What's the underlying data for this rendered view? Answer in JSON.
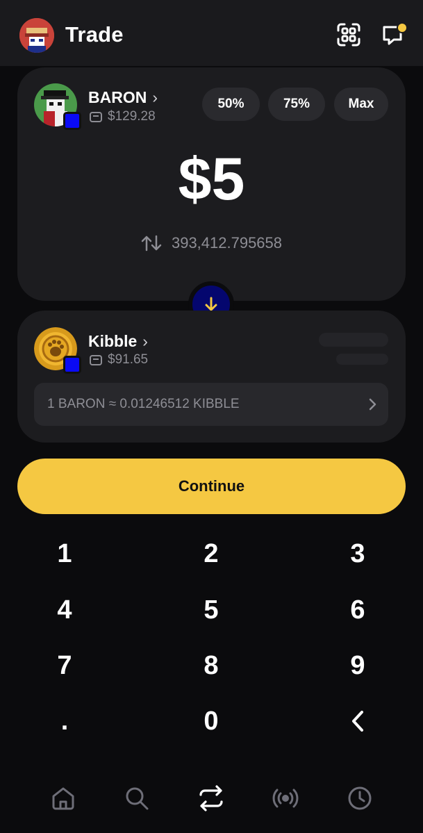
{
  "header": {
    "title": "Trade",
    "scan_icon": "scan-qr-icon",
    "chat_icon": "chat-notification-icon",
    "notification_color": "#f5c842"
  },
  "sell_token": {
    "name": "BARON",
    "balance": "$129.28",
    "chain_badge_color": "#0a0af5"
  },
  "percent_buttons": [
    "50%",
    "75%",
    "Max"
  ],
  "amount": "$5",
  "converted_amount": "393,412.795658",
  "swap_direction_icon": "arrow-down-icon",
  "buy_token": {
    "name": "Kibble",
    "balance": "$91.65"
  },
  "rate": "1 BARON ≈ 0.01246512 KIBBLE",
  "continue_label": "Continue",
  "keypad": {
    "keys": [
      "1",
      "2",
      "3",
      "4",
      "5",
      "6",
      "7",
      "8",
      "9",
      ".",
      "0"
    ],
    "backspace_icon": "chevron-left-icon"
  },
  "bottom_nav": [
    "home-icon",
    "search-icon",
    "swap-icon",
    "broadcast-icon",
    "clock-icon"
  ],
  "colors": {
    "accent": "#f5c842",
    "background": "#0b0b0d",
    "card": "#1c1c1f",
    "swap_button": "#04066e"
  }
}
